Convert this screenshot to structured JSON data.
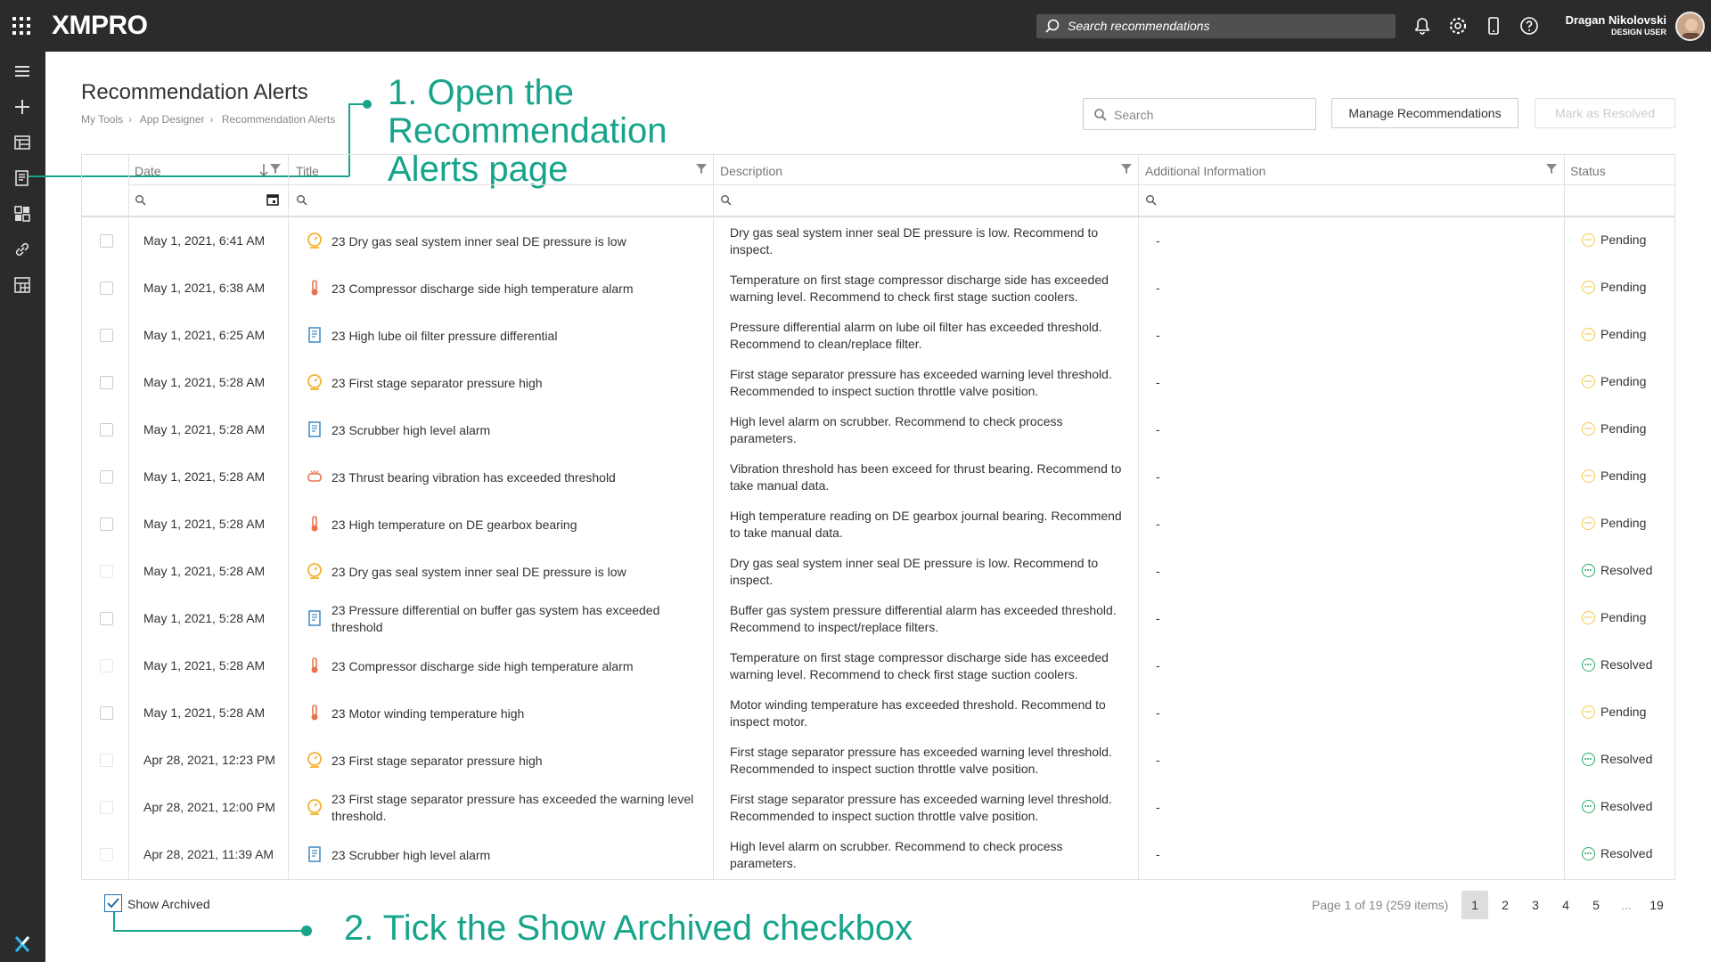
{
  "topbar": {
    "logo": "XMPRO",
    "search_placeholder": "Search recommendations",
    "user_name": "Dragan Nikolovski",
    "user_role": "DESIGN USER"
  },
  "page": {
    "title": "Recommendation Alerts",
    "breadcrumbs": [
      "My Tools",
      "App Designer",
      "Recommendation Alerts"
    ]
  },
  "toolbar": {
    "search_placeholder": "Search",
    "manage_label": "Manage Recommendations",
    "resolve_label": "Mark as Resolved"
  },
  "annotations": {
    "step1": "1. Open the Recommendation Alerts page",
    "step2": "2. Tick the Show Archived checkbox"
  },
  "table": {
    "columns": [
      "Date",
      "Title",
      "Description",
      "Additional Information",
      "Status"
    ],
    "rows": [
      {
        "date": "May 1, 2021, 6:41 AM",
        "icon": "pressure-gauge",
        "title": "23 Dry gas seal system inner seal DE pressure is low",
        "description": "Dry gas seal system inner seal DE pressure is low. Recommend to inspect.",
        "info": "-",
        "status": "Pending"
      },
      {
        "date": "May 1, 2021, 6:38 AM",
        "icon": "thermometer",
        "title": "23 Compressor discharge side high temperature alarm",
        "description": "Temperature on first stage compressor discharge side has exceeded warning level. Recommend to check first stage suction coolers.",
        "info": "-",
        "status": "Pending"
      },
      {
        "date": "May 1, 2021, 6:25 AM",
        "icon": "document",
        "title": "23 High lube oil filter pressure differential",
        "description": "Pressure differential alarm on lube oil filter has exceeded threshold. Recommend to clean/replace filter.",
        "info": "-",
        "status": "Pending"
      },
      {
        "date": "May 1, 2021, 5:28 AM",
        "icon": "pressure-gauge",
        "title": "23 First stage separator pressure high",
        "description": "First stage separator pressure has exceeded warning level threshold. Recommended to inspect suction throttle valve position.",
        "info": "-",
        "status": "Pending"
      },
      {
        "date": "May 1, 2021, 5:28 AM",
        "icon": "document",
        "title": "23 Scrubber high level alarm",
        "description": "High level alarm on scrubber. Recommend to check process parameters.",
        "info": "-",
        "status": "Pending"
      },
      {
        "date": "May 1, 2021, 5:28 AM",
        "icon": "vibration",
        "title": "23 Thrust bearing vibration has exceeded threshold",
        "description": "Vibration threshold has been exceed for thrust bearing. Recommend to take manual data.",
        "info": "-",
        "status": "Pending"
      },
      {
        "date": "May 1, 2021, 5:28 AM",
        "icon": "thermometer",
        "title": "23 High temperature on DE gearbox bearing",
        "description": "High temperature reading on DE gearbox journal bearing. Recommend to take manual data.",
        "info": "-",
        "status": "Pending"
      },
      {
        "date": "May 1, 2021, 5:28 AM",
        "icon": "pressure-gauge",
        "title": "23 Dry gas seal system inner seal DE pressure is low",
        "description": "Dry gas seal system inner seal DE pressure is low. Recommend to inspect.",
        "info": "-",
        "status": "Resolved"
      },
      {
        "date": "May 1, 2021, 5:28 AM",
        "icon": "document",
        "title": "23 Pressure differential on buffer gas system has exceeded threshold",
        "description": "Buffer gas system pressure differential alarm has exceeded threshold. Recommend to inspect/replace filters.",
        "info": "-",
        "status": "Pending"
      },
      {
        "date": "May 1, 2021, 5:28 AM",
        "icon": "thermometer",
        "title": "23 Compressor discharge side high temperature alarm",
        "description": "Temperature on first stage compressor discharge side has exceeded warning level. Recommend to check first stage suction coolers.",
        "info": "-",
        "status": "Resolved"
      },
      {
        "date": "May 1, 2021, 5:28 AM",
        "icon": "thermometer",
        "title": "23 Motor winding temperature high",
        "description": "Motor winding temperature has exceeded threshold. Recommend to inspect motor.",
        "info": "-",
        "status": "Pending"
      },
      {
        "date": "Apr 28, 2021, 12:23 PM",
        "icon": "pressure-gauge",
        "title": "23 First stage separator pressure high",
        "description": "First stage separator pressure has exceeded warning level threshold. Recommended to inspect suction throttle valve position.",
        "info": "-",
        "status": "Resolved"
      },
      {
        "date": "Apr 28, 2021, 12:00 PM",
        "icon": "pressure-gauge",
        "title": "23 First stage separator pressure has exceeded the warning level threshold.",
        "description": "First stage separator pressure has exceeded warning level threshold. Recommended to inspect suction throttle valve position.",
        "info": "-",
        "status": "Resolved"
      },
      {
        "date": "Apr 28, 2021, 11:39 AM",
        "icon": "document",
        "title": "23 Scrubber high level alarm",
        "description": "High level alarm on scrubber. Recommend to check process parameters.",
        "info": "-",
        "status": "Resolved"
      }
    ]
  },
  "footer": {
    "show_archived_label": "Show Archived",
    "show_archived_checked": true,
    "page_info": "Page 1 of 19 (259 items)",
    "pages": [
      "1",
      "2",
      "3",
      "4",
      "5",
      "...",
      "19"
    ]
  },
  "colors": {
    "accent": "#17a48b",
    "pending": "#f2c94c",
    "resolved": "#27ae60",
    "topbar": "#2b2b2b"
  }
}
